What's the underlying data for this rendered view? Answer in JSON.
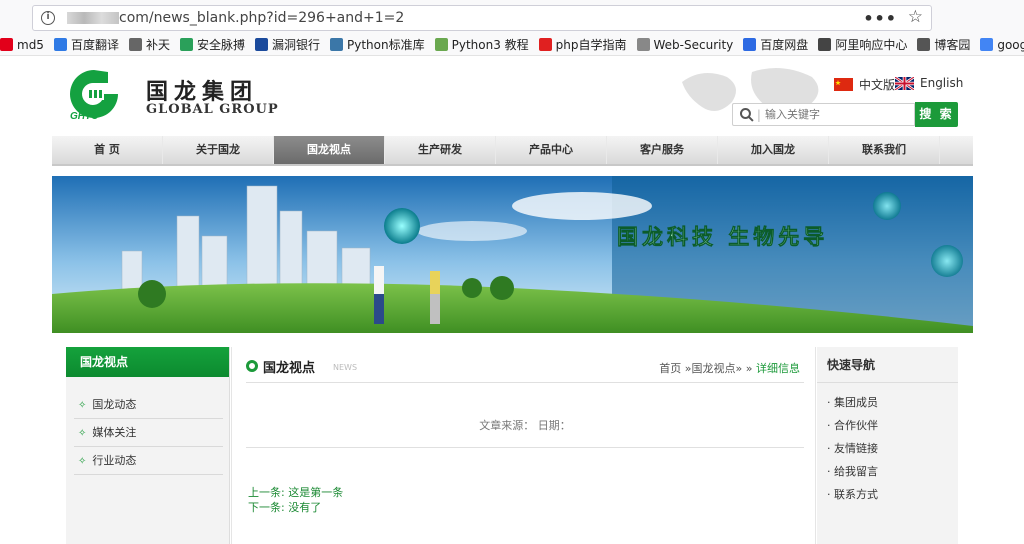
{
  "browser": {
    "url_text": "com/news_blank.php?id=296+and+1=2",
    "menu_glyph": "•••",
    "star_glyph": "☆",
    "bookmarks": [
      {
        "label": "md5",
        "icon": "md5-icon",
        "color": "#e2001a"
      },
      {
        "label": "百度翻译",
        "icon": "baidu-translate-icon",
        "color": "#2f7ae5"
      },
      {
        "label": "补天",
        "icon": "butian-icon",
        "color": "#666666"
      },
      {
        "label": "安全脉搏",
        "icon": "shield-icon",
        "color": "#2aa05a"
      },
      {
        "label": "漏洞银行",
        "icon": "bugbank-icon",
        "color": "#1b4a9c"
      },
      {
        "label": "Python标准库",
        "icon": "python-icon",
        "color": "#3b77a8"
      },
      {
        "label": "Python3 教程",
        "icon": "runoob-icon",
        "color": "#6aa84f"
      },
      {
        "label": "php自学指南",
        "icon": "php-icon",
        "color": "#e02020"
      },
      {
        "label": "Web-Security",
        "icon": "pin-icon",
        "color": "#888888"
      },
      {
        "label": "百度网盘",
        "icon": "baidu-pan-icon",
        "color": "#2d6ae3"
      },
      {
        "label": "阿里响应中心",
        "icon": "globe-icon",
        "color": "#444444"
      },
      {
        "label": "博客园",
        "icon": "cnblogs-icon",
        "color": "#555555"
      },
      {
        "label": "google.c",
        "icon": "google-icon",
        "color": "#4285f4"
      }
    ]
  },
  "site": {
    "logo_cn": "国龙集团",
    "logo_en": "GLOBAL GROUP",
    "logo_mark_text": "GHTC",
    "lang_cn": "中文版",
    "lang_en": "English",
    "search_placeholder": "输入关键字",
    "search_button": "搜 索",
    "nav": [
      "首 页",
      "关于国龙",
      "国龙视点",
      "生产研发",
      "产品中心",
      "客户服务",
      "加入国龙",
      "联系我们"
    ],
    "nav_active": 2,
    "banner_slogan": "国龙科技  生物先导",
    "left": {
      "title": "国龙视点",
      "items": [
        "国龙动态",
        "媒体关注",
        "行业动态"
      ]
    },
    "main": {
      "title": "国龙视点",
      "sub": "NEWS",
      "crumb_home": "首页",
      "crumb_section": "»国龙视点»",
      "crumb_sep": "»",
      "crumb_current": "详细信息",
      "meta": "文章来源：  日期：",
      "prev": "上一条: 这是第一条",
      "next": "下一条: 没有了"
    },
    "right": {
      "title": "快速导航",
      "items": [
        "· 集团成员",
        "· 合作伙伴",
        "· 友情链接",
        "· 给我留言",
        "· 联系方式"
      ]
    },
    "colors": {
      "accent": "#1c9a3a"
    }
  }
}
